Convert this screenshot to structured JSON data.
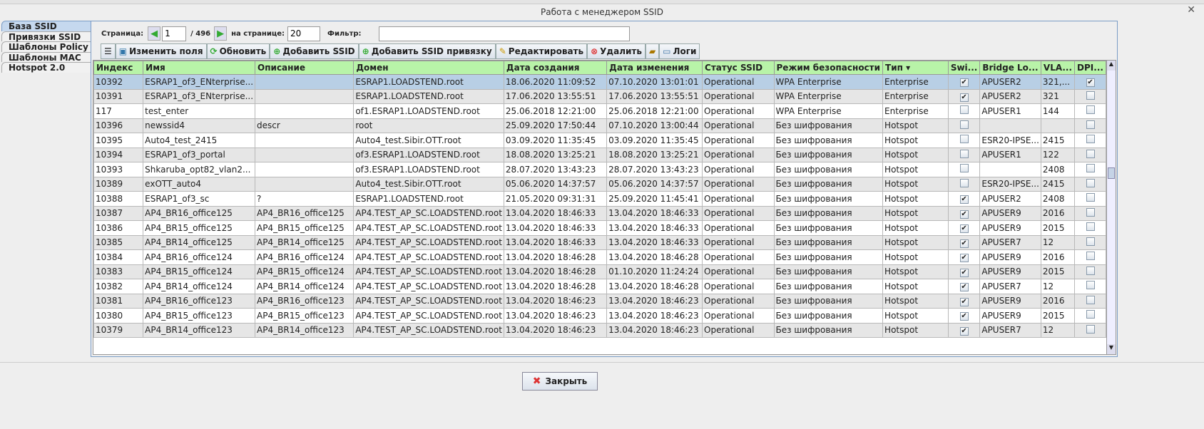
{
  "window": {
    "title": "Работа с менеджером SSID",
    "close": "✕"
  },
  "tabs": [
    "База SSID",
    "Привязки SSID",
    "Шаблоны Policy",
    "Шаблоны MAC",
    "Hotspot 2.0"
  ],
  "pager": {
    "page_label": "Страница:",
    "page": "1",
    "total": "/ 496",
    "per_page_label": "на странице:",
    "per_page": "20",
    "filter_label": "Фильтр:",
    "filter": ""
  },
  "toolbar": {
    "edit_fields": "Изменить поля",
    "refresh": "Обновить",
    "add_ssid": "Добавить SSID",
    "add_binding": "Добавить SSID привязку",
    "edit": "Редактировать",
    "delete": "Удалить",
    "logs": "Логи"
  },
  "columns": [
    "Индекс",
    "Имя",
    "Описание",
    "Домен",
    "Дата создания",
    "Дата изменения",
    "Статус SSID",
    "Режим безопасности",
    "Тип ▾",
    "Swi...",
    "Bridge Lo...",
    "VLA...",
    "DPI..."
  ],
  "rows": [
    [
      "10392",
      "ESRAP1_of3_ENterprise...",
      "",
      "ESRAP1.LOADSTEND.root",
      "18.06.2020 11:09:52",
      "07.10.2020 13:01:01",
      "Operational",
      "WPA Enterprise",
      "Enterprise",
      true,
      "APUSER2",
      "321,...",
      true
    ],
    [
      "10391",
      "ESRAP1_of3_ENterprise...",
      "",
      "ESRAP1.LOADSTEND.root",
      "17.06.2020 13:55:51",
      "17.06.2020 13:55:51",
      "Operational",
      "WPA Enterprise",
      "Enterprise",
      true,
      "APUSER2",
      "321",
      false
    ],
    [
      "117",
      "test_enter",
      "",
      "of1.ESRAP1.LOADSTEND.root",
      "25.06.2018 12:21:00",
      "25.06.2018 12:21:00",
      "Operational",
      "WPA Enterprise",
      "Enterprise",
      false,
      "APUSER1",
      "144",
      false
    ],
    [
      "10396",
      "newssid4",
      "descr",
      "root",
      "25.09.2020 17:50:44",
      "07.10.2020 13:00:44",
      "Operational",
      "Без шифрования",
      "Hotspot",
      false,
      "",
      "",
      false
    ],
    [
      "10395",
      "Auto4_test_2415",
      "",
      "Auto4_test.Sibir.OTT.root",
      "03.09.2020 11:35:45",
      "03.09.2020 11:35:45",
      "Operational",
      "Без шифрования",
      "Hotspot",
      false,
      "ESR20-IPSE...",
      "2415",
      false
    ],
    [
      "10394",
      "ESRAP1_of3_portal",
      "",
      "of3.ESRAP1.LOADSTEND.root",
      "18.08.2020 13:25:21",
      "18.08.2020 13:25:21",
      "Operational",
      "Без шифрования",
      "Hotspot",
      false,
      "APUSER1",
      "122",
      false
    ],
    [
      "10393",
      "Shkaruba_opt82_vlan2...",
      "",
      "of3.ESRAP1.LOADSTEND.root",
      "28.07.2020 13:43:23",
      "28.07.2020 13:43:23",
      "Operational",
      "Без шифрования",
      "Hotspot",
      false,
      "",
      "2408",
      false
    ],
    [
      "10389",
      "exOTT_auto4",
      "",
      "Auto4_test.Sibir.OTT.root",
      "05.06.2020 14:37:57",
      "05.06.2020 14:37:57",
      "Operational",
      "Без шифрования",
      "Hotspot",
      false,
      "ESR20-IPSE...",
      "2415",
      false
    ],
    [
      "10388",
      "ESRAP1_of3_sc",
      "?",
      "ESRAP1.LOADSTEND.root",
      "21.05.2020 09:31:31",
      "25.09.2020 11:45:41",
      "Operational",
      "Без шифрования",
      "Hotspot",
      true,
      "APUSER2",
      "2408",
      false
    ],
    [
      "10387",
      "AP4_BR16_office125",
      "AP4_BR16_office125",
      "AP4.TEST_AP_SC.LOADSTEND.root",
      "13.04.2020 18:46:33",
      "13.04.2020 18:46:33",
      "Operational",
      "Без шифрования",
      "Hotspot",
      true,
      "APUSER9",
      "2016",
      false
    ],
    [
      "10386",
      "AP4_BR15_office125",
      "AP4_BR15_office125",
      "AP4.TEST_AP_SC.LOADSTEND.root",
      "13.04.2020 18:46:33",
      "13.04.2020 18:46:33",
      "Operational",
      "Без шифрования",
      "Hotspot",
      true,
      "APUSER9",
      "2015",
      false
    ],
    [
      "10385",
      "AP4_BR14_office125",
      "AP4_BR14_office125",
      "AP4.TEST_AP_SC.LOADSTEND.root",
      "13.04.2020 18:46:33",
      "13.04.2020 18:46:33",
      "Operational",
      "Без шифрования",
      "Hotspot",
      true,
      "APUSER7",
      "12",
      false
    ],
    [
      "10384",
      "AP4_BR16_office124",
      "AP4_BR16_office124",
      "AP4.TEST_AP_SC.LOADSTEND.root",
      "13.04.2020 18:46:28",
      "13.04.2020 18:46:28",
      "Operational",
      "Без шифрования",
      "Hotspot",
      true,
      "APUSER9",
      "2016",
      false
    ],
    [
      "10383",
      "AP4_BR15_office124",
      "AP4_BR15_office124",
      "AP4.TEST_AP_SC.LOADSTEND.root",
      "13.04.2020 18:46:28",
      "01.10.2020 11:24:24",
      "Operational",
      "Без шифрования",
      "Hotspot",
      true,
      "APUSER9",
      "2015",
      false
    ],
    [
      "10382",
      "AP4_BR14_office124",
      "AP4_BR14_office124",
      "AP4.TEST_AP_SC.LOADSTEND.root",
      "13.04.2020 18:46:28",
      "13.04.2020 18:46:28",
      "Operational",
      "Без шифрования",
      "Hotspot",
      true,
      "APUSER7",
      "12",
      false
    ],
    [
      "10381",
      "AP4_BR16_office123",
      "AP4_BR16_office123",
      "AP4.TEST_AP_SC.LOADSTEND.root",
      "13.04.2020 18:46:23",
      "13.04.2020 18:46:23",
      "Operational",
      "Без шифрования",
      "Hotspot",
      true,
      "APUSER9",
      "2016",
      false
    ],
    [
      "10380",
      "AP4_BR15_office123",
      "AP4_BR15_office123",
      "AP4.TEST_AP_SC.LOADSTEND.root",
      "13.04.2020 18:46:23",
      "13.04.2020 18:46:23",
      "Operational",
      "Без шифрования",
      "Hotspot",
      true,
      "APUSER9",
      "2015",
      false
    ],
    [
      "10379",
      "AP4_BR14_office123",
      "AP4_BR14_office123",
      "AP4.TEST_AP_SC.LOADSTEND.root",
      "13.04.2020 18:46:23",
      "13.04.2020 18:46:23",
      "Operational",
      "Без шифрования",
      "Hotspot",
      true,
      "APUSER7",
      "12",
      false
    ]
  ],
  "footer": {
    "close": "Закрыть"
  }
}
